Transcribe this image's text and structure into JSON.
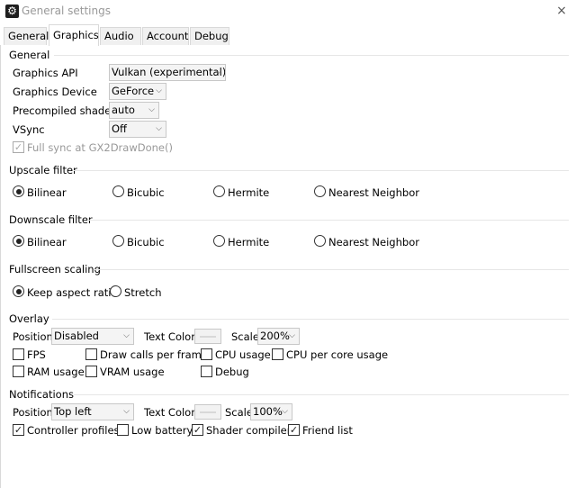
{
  "window": {
    "title": "General settings",
    "close_glyph": "×",
    "app_icon": "gear-icon"
  },
  "tabs": [
    {
      "label": "General"
    },
    {
      "label": "Graphics",
      "active": true
    },
    {
      "label": "Audio"
    },
    {
      "label": "Account"
    },
    {
      "label": "Debug"
    }
  ],
  "general": {
    "heading": "General",
    "graphics_api": {
      "label": "Graphics API",
      "value": "Vulkan (experimental)"
    },
    "graphics_device": {
      "label": "Graphics Device",
      "value": "GeForce"
    },
    "precompiled_shaders": {
      "label": "Precompiled shaders",
      "value": "auto"
    },
    "vsync": {
      "label": "VSync",
      "value": "Off"
    },
    "full_sync": {
      "label": "Full sync at GX2DrawDone()",
      "checked": true,
      "enabled": false
    }
  },
  "upscale": {
    "heading": "Upscale filter",
    "options": [
      "Bilinear",
      "Bicubic",
      "Hermite",
      "Nearest Neighbor"
    ],
    "selected": "Bilinear"
  },
  "downscale": {
    "heading": "Downscale filter",
    "options": [
      "Bilinear",
      "Bicubic",
      "Hermite",
      "Nearest Neighbor"
    ],
    "selected": "Bilinear"
  },
  "fullscreen": {
    "heading": "Fullscreen scaling",
    "options": [
      "Keep aspect ratio",
      "Stretch"
    ],
    "selected": "Keep aspect ratio"
  },
  "overlay": {
    "heading": "Overlay",
    "position_label": "Position",
    "position_value": "Disabled",
    "text_color_label": "Text Color",
    "scale_label": "Scale",
    "scale_value": "200%",
    "checks": [
      {
        "label": "FPS",
        "checked": false
      },
      {
        "label": "Draw calls per frame",
        "checked": false
      },
      {
        "label": "CPU usage",
        "checked": false
      },
      {
        "label": "CPU per core usage",
        "checked": false
      },
      {
        "label": "RAM usage",
        "checked": false
      },
      {
        "label": "VRAM usage",
        "checked": false
      },
      {
        "label": "Debug",
        "checked": false
      }
    ]
  },
  "notifications": {
    "heading": "Notifications",
    "position_label": "Position",
    "position_value": "Top left",
    "text_color_label": "Text Color",
    "scale_label": "Scale",
    "scale_value": "100%",
    "checks": [
      {
        "label": "Controller profiles",
        "checked": true
      },
      {
        "label": "Low battery",
        "checked": false
      },
      {
        "label": "Shader compiler",
        "checked": true
      },
      {
        "label": "Friend list",
        "checked": true
      }
    ]
  },
  "colors": {
    "border": "#d9d9d9",
    "combo_bg": "#f4f4f4",
    "disabled_text": "#999999"
  }
}
